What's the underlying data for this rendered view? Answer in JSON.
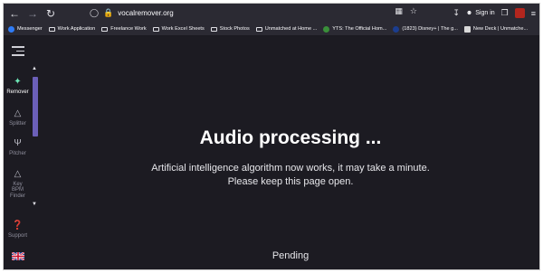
{
  "browser": {
    "url": "vocalremover.org",
    "sign_in_label": "Sign in",
    "bookmarks": [
      {
        "label": "Messenger",
        "icon": "messenger-icon"
      },
      {
        "label": "Work Application",
        "icon": "folder-icon"
      },
      {
        "label": "Freelance Work",
        "icon": "folder-icon"
      },
      {
        "label": "Work Excel Sheets",
        "icon": "folder-icon"
      },
      {
        "label": "Stock Photos",
        "icon": "folder-icon"
      },
      {
        "label": "Unmatched at Home ...",
        "icon": "folder-icon"
      },
      {
        "label": "YTS: The Official Hom...",
        "icon": "yts-icon"
      },
      {
        "label": "(1823) Disney+ | The g...",
        "icon": "disney-icon"
      },
      {
        "label": "New Deck | Unmatche...",
        "icon": "deck-icon"
      }
    ]
  },
  "sidebar": {
    "items": [
      {
        "label": "Remover",
        "icon": "remover-icon"
      },
      {
        "label": "Splitter",
        "icon": "splitter-icon"
      },
      {
        "label": "Pitcher",
        "icon": "tuning-fork-icon"
      },
      {
        "label": "Key BPM Finder",
        "line1": "Key",
        "line2": "BPM",
        "line3": "Finder",
        "icon": "metronome-icon"
      },
      {
        "label": "Support",
        "icon": "help-icon"
      }
    ],
    "language_flag": "uk-flag-icon"
  },
  "main": {
    "title": "Audio processing ...",
    "line1": "Artificial intelligence algorithm now works, it may take a minute.",
    "line2": "Please keep this page open.",
    "status": "Pending"
  },
  "colors": {
    "background": "#1c1b22",
    "chrome": "#2b2a33",
    "scroll_thumb": "#6b5fb8"
  }
}
